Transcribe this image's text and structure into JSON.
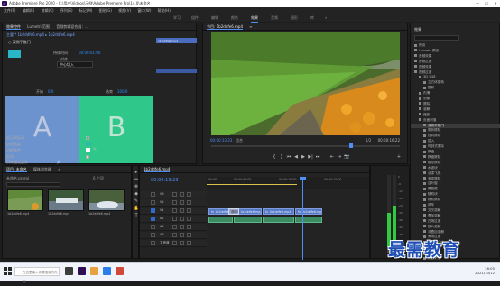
{
  "window": {
    "app_icon": "Pr",
    "title": "Adobe Premiere Pro 2020 - C:\\用户\\Videos\\示例\\Adobe Premiere Pro\\14.0\\未命名",
    "minimize": "—",
    "maximize": "☐",
    "close": "✕"
  },
  "menu": [
    "文件(F)",
    "编辑(E)",
    "剪辑(C)",
    "序列(S)",
    "标记(M)",
    "图形(G)",
    "视图(V)",
    "窗口(W)",
    "帮助(H)"
  ],
  "workspaces": {
    "items": [
      "学习",
      "组件",
      "编辑",
      "颜色",
      "效果",
      "音频",
      "图形",
      "库",
      "»"
    ],
    "active": "效果"
  },
  "effect_controls": {
    "tabs": [
      "效果控件",
      "Lumetri 范围",
      "音频剪辑混合器：..."
    ],
    "active_tab": "效果控件",
    "source": "主要 * 1b2ddfe6.mp4 ▸ 1b2ddfe6.mp4",
    "clip_label": "1b2ddfe6.mp4",
    "effect_name": "○ 双侧平推门",
    "property_rows": [
      {
        "label": "持续时间",
        "value": "00:00:01:00"
      },
      {
        "label": "对齐",
        "value": "中心切入"
      },
      {
        "label": "开始",
        "value": "0.0"
      },
      {
        "label": "结束",
        "value": "100.0"
      }
    ],
    "align_select": "中心切入",
    "box_a_letter": "A",
    "box_b_letter": "B",
    "flags": [
      {
        "label": "显示实际源",
        "checked": false
      },
      {
        "label": "边框宽度",
        "value": "0.0"
      },
      {
        "label": "边框颜色",
        "value": ""
      },
      {
        "label": "反向",
        "checked": true
      },
      {
        "label": "消除锯齿品质",
        "value": "关"
      }
    ],
    "footer_timecode": "00:00:16:22"
  },
  "program_monitor": {
    "tabs": [
      "节目: 1b2ddfe6.mp4",
      "≡"
    ],
    "timecode": "00:00:13:23",
    "fit": "适合",
    "resolution": "1/2",
    "duration": "00:00:16:22",
    "controls": [
      "{",
      "}",
      "⏮",
      "◀",
      "▶",
      "▶|",
      "⏭",
      "⇤",
      "⇥",
      "📷",
      "+"
    ]
  },
  "effects_panel": {
    "title": "效果",
    "items": [
      {
        "label": "预设",
        "level": 0,
        "selected": false
      },
      {
        "label": "Lumetri 预设",
        "level": 0,
        "selected": false
      },
      {
        "label": "音频效果",
        "level": 0,
        "selected": false
      },
      {
        "label": "音频过渡",
        "level": 0,
        "selected": false
      },
      {
        "label": "视频效果",
        "level": 0,
        "selected": false
      },
      {
        "label": "视频过渡",
        "level": 0,
        "selected": false
      },
      {
        "label": "3D 运动",
        "level": 1,
        "selected": false
      },
      {
        "label": "立方体旋转",
        "level": 2,
        "selected": false
      },
      {
        "label": "翻转",
        "level": 2,
        "selected": false
      },
      {
        "label": "内滑",
        "level": 1,
        "selected": false
      },
      {
        "label": "划像",
        "level": 1,
        "selected": false
      },
      {
        "label": "擦除",
        "level": 1,
        "selected": false
      },
      {
        "label": "溶解",
        "level": 1,
        "selected": false
      },
      {
        "label": "缩放",
        "level": 1,
        "selected": false
      },
      {
        "label": "页面剥落",
        "level": 1,
        "selected": false
      },
      {
        "label": "双侧平推门",
        "level": 2,
        "selected": true
      },
      {
        "label": "带状擦除",
        "level": 2,
        "selected": false
      },
      {
        "label": "径向擦除",
        "level": 2,
        "selected": false
      },
      {
        "label": "插入",
        "level": 2,
        "selected": false
      },
      {
        "label": "时钟式擦除",
        "level": 2,
        "selected": false
      },
      {
        "label": "棋盘",
        "level": 2,
        "selected": false
      },
      {
        "label": "棋盘擦除",
        "level": 2,
        "selected": false
      },
      {
        "label": "楔形擦除",
        "level": 2,
        "selected": false
      },
      {
        "label": "水波块",
        "level": 2,
        "selected": false
      },
      {
        "label": "油漆飞溅",
        "level": 2,
        "selected": false
      },
      {
        "label": "渐变擦除",
        "level": 2,
        "selected": false
      },
      {
        "label": "百叶窗",
        "level": 2,
        "selected": false
      },
      {
        "label": "螺旋框",
        "level": 2,
        "selected": false
      },
      {
        "label": "随机块",
        "level": 2,
        "selected": false
      },
      {
        "label": "随机擦除",
        "level": 2,
        "selected": false
      },
      {
        "label": "风车",
        "level": 2,
        "selected": false
      },
      {
        "label": "交叉溶解",
        "level": 2,
        "selected": false
      },
      {
        "label": "叠加溶解",
        "level": 2,
        "selected": false
      },
      {
        "label": "白场过渡",
        "level": 2,
        "selected": false
      },
      {
        "label": "胶片溶解",
        "level": 2,
        "selected": false
      },
      {
        "label": "非叠加溶解",
        "level": 2,
        "selected": false
      },
      {
        "label": "黑场过渡",
        "level": 2,
        "selected": false
      },
      {
        "label": "MorphCut",
        "level": 2,
        "selected": false
      },
      {
        "label": "交叉缩放",
        "level": 2,
        "selected": false
      },
      {
        "label": "翻页",
        "level": 2,
        "selected": false
      },
      {
        "label": "页面剥落",
        "level": 2,
        "selected": false
      }
    ]
  },
  "project": {
    "tabs": [
      "项目: 未命名",
      "媒体浏览器",
      "»"
    ],
    "name": "未命名.prproj",
    "item_count": "6 个项",
    "thumbs": [
      {
        "caption": "1b2ddfe6.mp4",
        "duration": "16:22"
      },
      {
        "caption": "1b2ddfe6.mp4",
        "duration": "16:22"
      },
      {
        "caption": "1b2ddfe6.mp4",
        "duration": "16:22"
      }
    ]
  },
  "tools": [
    "▸",
    "⇹",
    "✥",
    "◆",
    "✎",
    "✋",
    "T"
  ],
  "timeline": {
    "tab": "1b2ddfe6.mp4",
    "timecode": "00:00:13:23",
    "ruler_labels": [
      "00:00",
      "00:00:05:00",
      "00:00:10:00",
      "00:00:15:00"
    ],
    "tracks": [
      {
        "name": "V3",
        "type": "video"
      },
      {
        "name": "V2",
        "type": "video"
      },
      {
        "name": "V1",
        "type": "video"
      },
      {
        "name": "A1",
        "type": "audio"
      },
      {
        "name": "A2",
        "type": "audio"
      },
      {
        "name": "A3",
        "type": "audio"
      },
      {
        "name": "主声道",
        "type": "master",
        "value": "0.0"
      }
    ],
    "video_clips": [
      "fx 1b2ddfe6.mp4",
      "fx 1b2ddfe6.mp4",
      "fx 1b2ddfe6.mp4",
      "fx 1b2ddfe6.mp4"
    ],
    "transition_label": "双侧平推",
    "audio_clips": [
      "",
      "",
      "",
      ""
    ]
  },
  "meters": {
    "scale": [
      "0",
      "-6",
      "-12",
      "-18",
      "-24",
      "-30",
      "-36",
      "-42",
      "-48",
      "-54",
      "dB"
    ],
    "left_level": 0.48,
    "right_level": 0.58,
    "solo": [
      "S",
      "S"
    ]
  },
  "watermark": "最需教育",
  "taskbar": {
    "search_placeholder": "在这里输入你要搜索的内容",
    "time": "16:05",
    "date": "2021/10/12"
  }
}
